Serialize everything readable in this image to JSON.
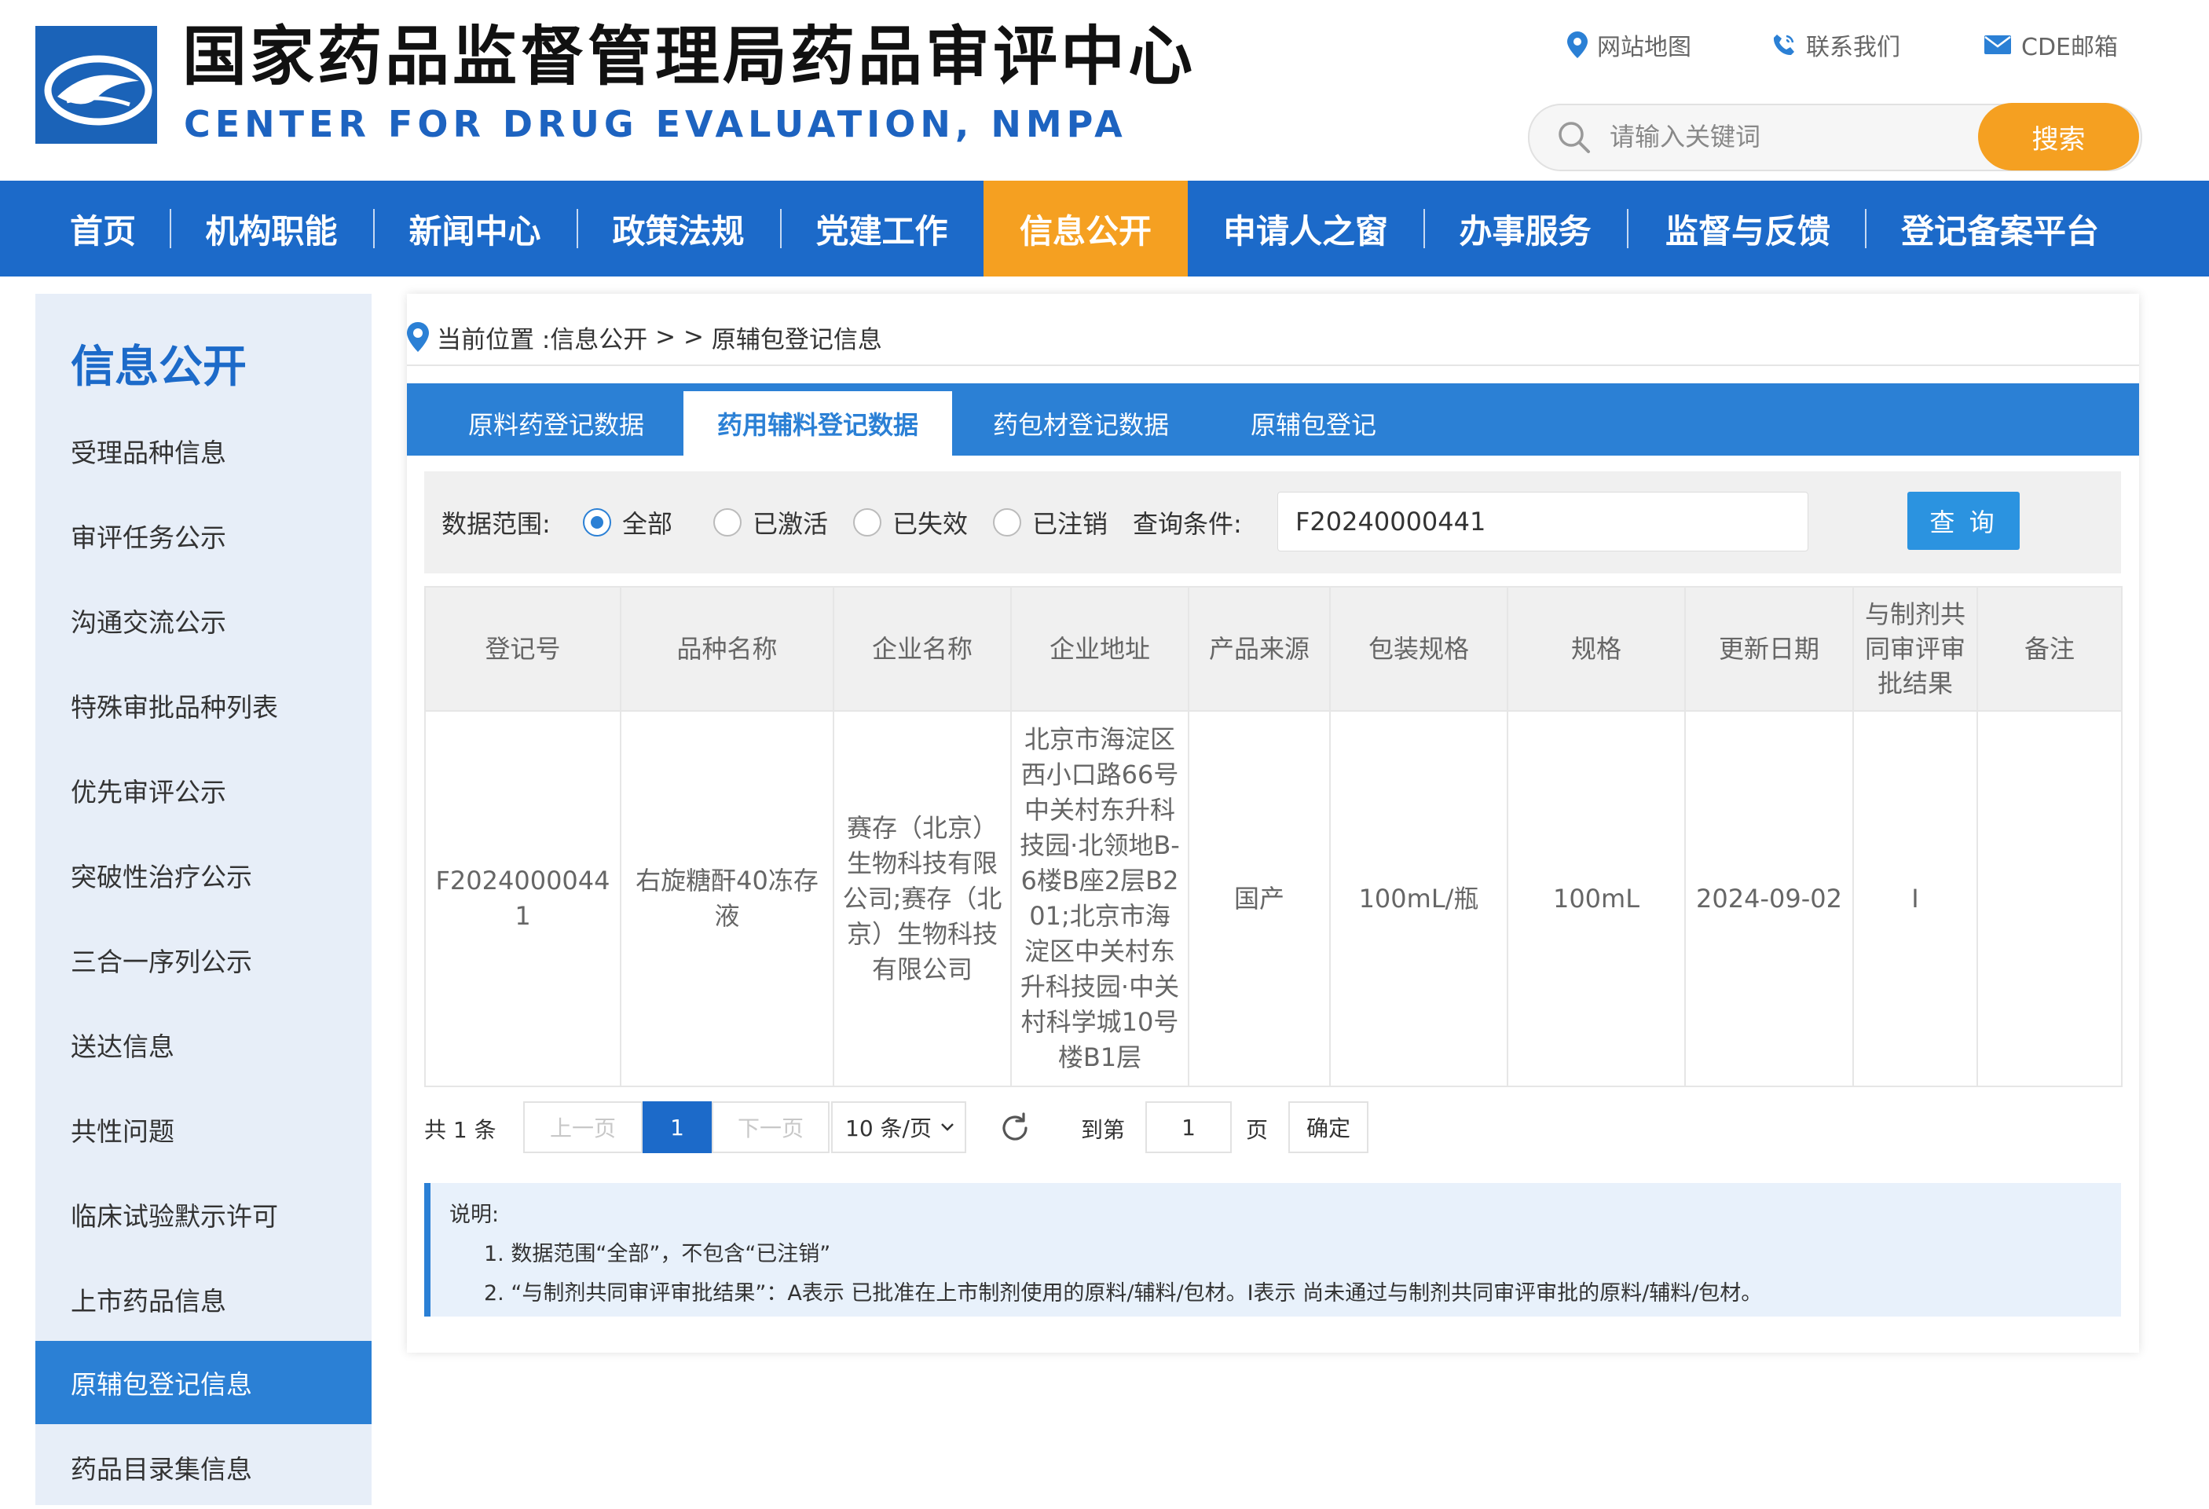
{
  "header": {
    "title_cn": "国家药品监督管理局药品审评中心",
    "title_en": "CENTER FOR DRUG EVALUATION, NMPA",
    "top_links": [
      {
        "label": "网站地图",
        "icon": "location-pin-icon"
      },
      {
        "label": "联系我们",
        "icon": "phone-icon"
      },
      {
        "label": "CDE邮箱",
        "icon": "mail-icon"
      }
    ],
    "search": {
      "placeholder": "请输入关键词",
      "button": "搜索"
    }
  },
  "nav": {
    "items": [
      "首页",
      "机构职能",
      "新闻中心",
      "政策法规",
      "党建工作",
      "信息公开",
      "申请人之窗",
      "办事服务",
      "监督与反馈",
      "登记备案平台"
    ],
    "active": "信息公开"
  },
  "sidebar": {
    "title": "信息公开",
    "items": [
      "受理品种信息",
      "审评任务公示",
      "沟通交流公示",
      "特殊审批品种列表",
      "优先审评公示",
      "突破性治疗公示",
      "三合一序列公示",
      "送达信息",
      "共性问题",
      "临床试验默示许可",
      "上市药品信息",
      "原辅包登记信息",
      "药品目录集信息"
    ],
    "active": "原辅包登记信息"
  },
  "breadcrumb": {
    "prefix": "当前位置 : ",
    "parent": "信息公开",
    "sep": " > > ",
    "current": "原辅包登记信息"
  },
  "tabs": {
    "items": [
      "原料药登记数据",
      "药用辅料登记数据",
      "药包材登记数据",
      "原辅包登记"
    ],
    "active": "药用辅料登记数据"
  },
  "filter": {
    "scope_label": "数据范围:",
    "options": [
      "全部",
      "已激活",
      "已失效",
      "已注销"
    ],
    "selected": "全部",
    "query_label": "查询条件:",
    "query_value": "F20240000441",
    "query_button": "查 询"
  },
  "table": {
    "headers": [
      "登记号",
      "品种名称",
      "企业名称",
      "企业地址",
      "产品来源",
      "包装规格",
      "规格",
      "更新日期",
      "与制剂共同审评审批结果",
      "备注"
    ],
    "rows": [
      [
        "F20240000441",
        "右旋糖酐40冻存液",
        "赛存（北京）生物科技有限公司;赛存（北京）生物科技有限公司",
        "北京市海淀区西小口路66号中关村东升科技园·北领地B-6楼B座2层B201;北京市海淀区中关村东升科技园·中关村科学城10号楼B1层",
        "国产",
        "100mL/瓶",
        "100mL",
        "2024-09-02",
        "I",
        ""
      ]
    ]
  },
  "pagination": {
    "total": "共 1 条",
    "prev": "上一页",
    "current": "1",
    "next": "下一页",
    "page_size": "10 条/页",
    "goto_label": "到第",
    "goto_value": "1",
    "page_unit": "页",
    "confirm": "确定"
  },
  "notes": {
    "title": "说明:",
    "lines": [
      "1. 数据范围“全部”，不包含“已注销”",
      "2. “与制剂共同审评审批结果”：A表示 已批准在上市制剂使用的原料/辅料/包材。I表示 尚未通过与制剂共同审评审批的原料/辅料/包材。"
    ]
  },
  "colors": {
    "nav_blue": "#1c6ac9",
    "tab_blue": "#2b80d5",
    "accent_orange": "#f5a021",
    "sidebar_bg": "#e7eef8"
  }
}
